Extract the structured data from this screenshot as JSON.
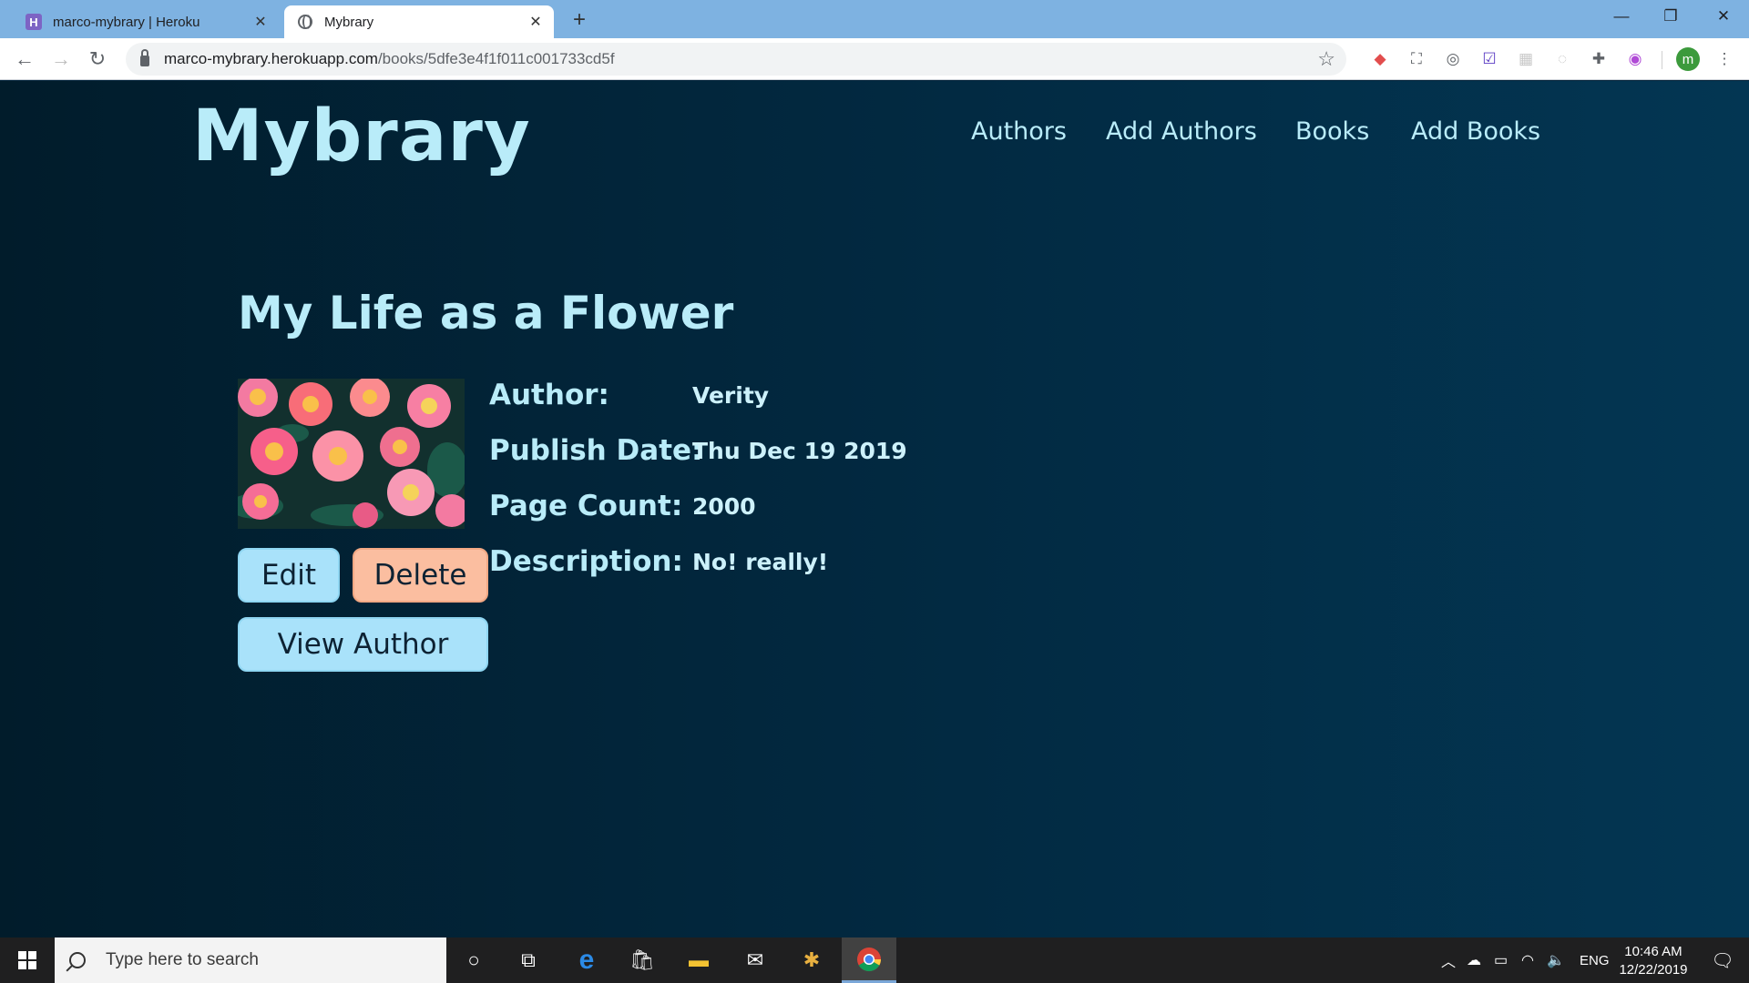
{
  "browser": {
    "tabs": [
      {
        "title": "marco-mybrary | Heroku",
        "favicon": "heroku-icon"
      },
      {
        "title": "Mybrary",
        "favicon": "globe-icon"
      }
    ],
    "url_host": "marco-mybrary.herokuapp.com",
    "url_path": "/books/5dfe3e4f1f011c001733cd5f",
    "profile_initial": "m"
  },
  "site": {
    "brand": "Mybrary",
    "nav": [
      "Authors",
      "Add Authors",
      "Books",
      "Add Books"
    ]
  },
  "book": {
    "title": "My Life as a Flower",
    "cover_icon": "flower-cover-image",
    "details": [
      {
        "label": "Author:",
        "value": "Verity"
      },
      {
        "label": "Publish Date:",
        "value": "Thu Dec 19 2019"
      },
      {
        "label": "Page Count:",
        "value": "2000"
      },
      {
        "label": "Description:",
        "value": "No! really!"
      }
    ],
    "buttons": {
      "edit": "Edit",
      "delete": "Delete",
      "view_author": "View Author"
    }
  },
  "taskbar": {
    "search_placeholder": "Type here to search",
    "language": "ENG",
    "time": "10:46 AM",
    "date": "12/22/2019"
  },
  "colors": {
    "accent_text": "#b9ecf9",
    "button_blue": "#a9e2fa",
    "button_peach": "#fbbea0",
    "page_bg": "#03233a"
  }
}
